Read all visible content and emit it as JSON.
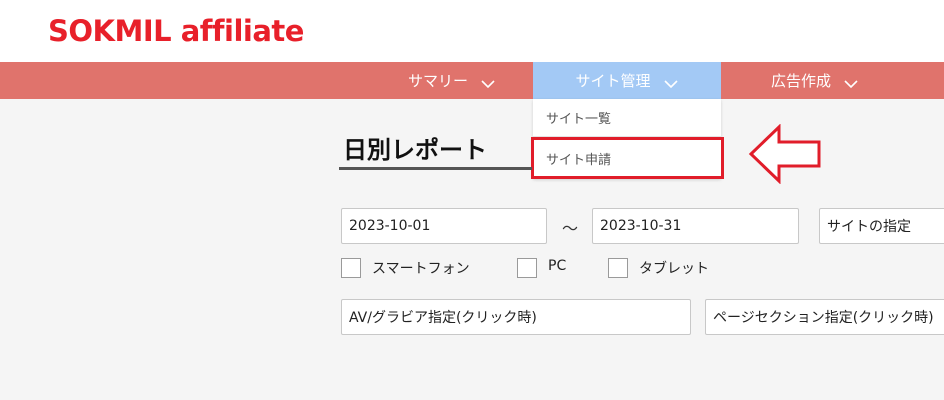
{
  "header": {
    "logo_text": "SOKMIL affiliate"
  },
  "nav": {
    "items": [
      {
        "label": "サマリー",
        "active": false
      },
      {
        "label": "サイト管理",
        "active": true
      },
      {
        "label": "広告作成",
        "active": false
      }
    ]
  },
  "dropdown": {
    "items": [
      {
        "label": "サイト一覧"
      },
      {
        "label": "サイト申請"
      }
    ]
  },
  "page": {
    "title": "日別レポート"
  },
  "filters": {
    "start_date": "2023-10-01",
    "separator": "～",
    "end_date": "2023-10-31",
    "site_select": "サイトの指定",
    "devices": [
      {
        "label": "スマートフォン",
        "checked": false
      },
      {
        "label": "PC",
        "checked": false
      },
      {
        "label": "タブレット",
        "checked": false
      }
    ],
    "av_select": "AV/グラビア指定(クリック時)",
    "page_section_select": "ページセクション指定(クリック時)"
  },
  "colors": {
    "brand": "#e8202a",
    "nav_bg": "#e0736c",
    "nav_active": "#a3c9f5",
    "highlight": "#e11d2a"
  }
}
